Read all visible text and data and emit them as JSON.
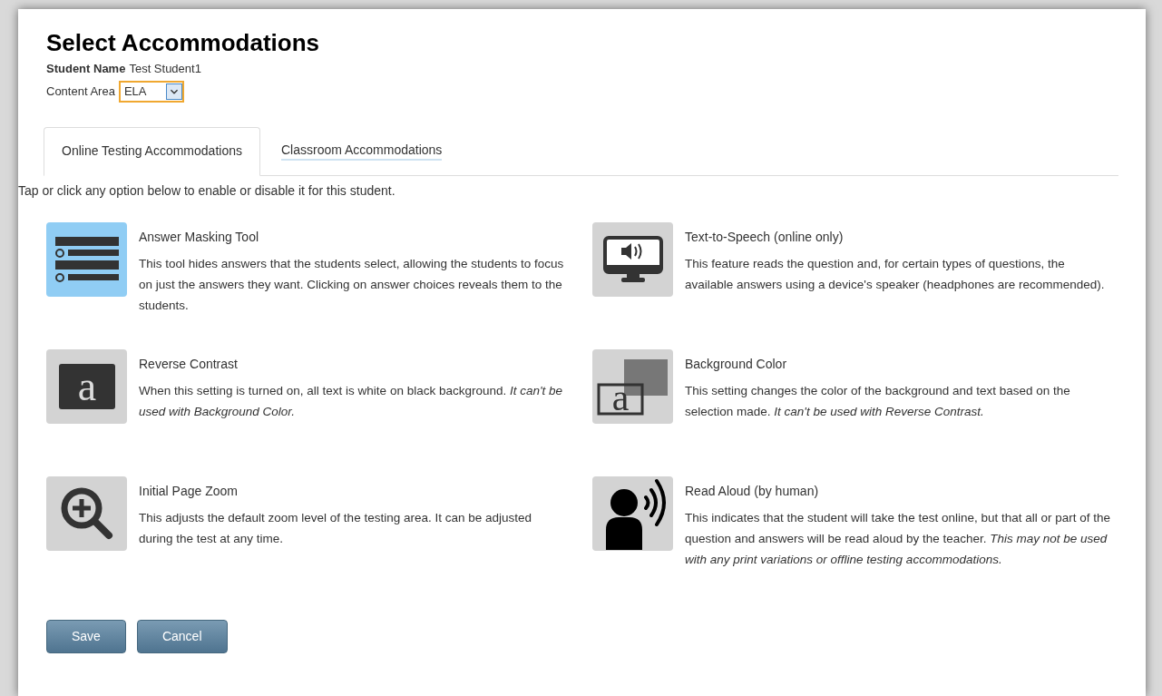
{
  "title": "Select Accommodations",
  "student": {
    "label": "Student Name",
    "value": "Test Student1"
  },
  "content_area": {
    "label": "Content Area",
    "value": "ELA"
  },
  "tabs": [
    {
      "label": "Online Testing Accommodations",
      "selected": true
    },
    {
      "label": "Classroom Accommodations",
      "selected": false
    }
  ],
  "instructions": "Tap or click any option below to enable or disable it for this student.",
  "options": [
    {
      "kind": "masking",
      "name": "Answer Masking Tool",
      "description": "This tool hides answers that the students select, allowing the students to focus on just the answers they want. Clicking on answer choices reveals them to the students.",
      "enabled": true
    },
    {
      "kind": "speech",
      "name": "Text-to-Speech (online only)",
      "description": "This feature reads the question and, for certain types of questions, the available answers using a device's speaker (headphones are recommended).",
      "enabled": false
    },
    {
      "kind": "contrast",
      "glyph": "a",
      "name": "Reverse Contrast",
      "description": "When this setting is turned on, all text is white on black background. *It can't be used with Background Color.*",
      "enabled": false
    },
    {
      "kind": "color",
      "glyph": "a",
      "name": "Background Color",
      "description": "This setting changes the color of the background and text based on the selection made. *It can't be used with Reverse Contrast.*",
      "enabled": false
    },
    {
      "kind": "zoom",
      "name": "Initial Page Zoom",
      "description": "This adjusts the default zoom level of the testing area. It can be adjusted during the test at any time.",
      "enabled": false
    },
    {
      "kind": "aloud",
      "name": "Read Aloud (by human)",
      "description": "This indicates that the student will take the test online, but that all or part of the question and answers will be read aloud by the teacher. *This may not be used with any print variations or offline testing accommodations.*",
      "enabled": false
    }
  ],
  "buttons": [
    "Save",
    "Cancel"
  ]
}
